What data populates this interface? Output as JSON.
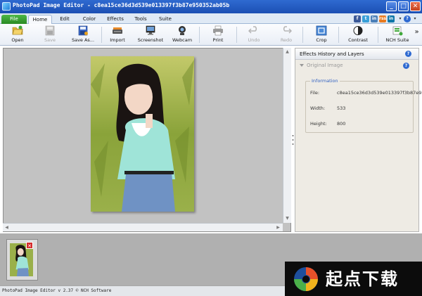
{
  "window": {
    "title": "PhotoPad Image Editor - c8ea15ce36d3d539e013397f3b87e950352ab05b",
    "minimize": "_",
    "maximize": "□",
    "close": "✕"
  },
  "menu": {
    "tabs": [
      "File",
      "Home",
      "Edit",
      "Color",
      "Effects",
      "Tools",
      "Suite"
    ],
    "active_tab": "Home",
    "social": [
      "f",
      "t",
      "in",
      "rss",
      "in"
    ],
    "dropdown": "▾",
    "help": "?"
  },
  "toolbar": {
    "buttons": [
      {
        "label": "Open",
        "icon": "open-folder-icon",
        "enabled": true
      },
      {
        "label": "Save",
        "icon": "floppy-disk-icon",
        "enabled": false
      },
      {
        "label": "Save As...",
        "icon": "save-as-icon",
        "enabled": true
      },
      {
        "label": "Import",
        "icon": "scanner-icon",
        "enabled": true
      },
      {
        "label": "Screenshot",
        "icon": "screenshot-icon",
        "enabled": true
      },
      {
        "label": "Webcam",
        "icon": "webcam-icon",
        "enabled": true
      },
      {
        "label": "Print",
        "icon": "printer-icon",
        "enabled": true
      },
      {
        "label": "Undo",
        "icon": "undo-icon",
        "enabled": false
      },
      {
        "label": "Redo",
        "icon": "redo-icon",
        "enabled": false
      },
      {
        "label": "Crop",
        "icon": "crop-icon",
        "enabled": true
      },
      {
        "label": "Contrast",
        "icon": "contrast-icon",
        "enabled": true
      },
      {
        "label": "NCH Suite",
        "icon": "nch-suite-icon",
        "enabled": true
      }
    ],
    "more": "»"
  },
  "panel": {
    "title": "Effects History and Layers",
    "help": "?",
    "layer_name": "Original Image",
    "info": {
      "legend": "Information",
      "file_label": "File:",
      "file_value": "c8ea15ce36d3d539e013397f3b87e95",
      "width_label": "Width:",
      "width_value": "533",
      "height_label": "Height:",
      "height_value": "800"
    }
  },
  "thumbnail": {
    "close": "✕"
  },
  "status": {
    "text": "PhotoPad Image Editor v 2.37 © NCH Software"
  },
  "watermark": {
    "text": "起点下载"
  },
  "colors": {
    "titlebar": "#1b4fb3",
    "file_tab": "#2a8a24",
    "canvas_bg": "#c2c2c2",
    "panel_bg": "#eeebe4",
    "info_accent": "#2f5fc0"
  }
}
